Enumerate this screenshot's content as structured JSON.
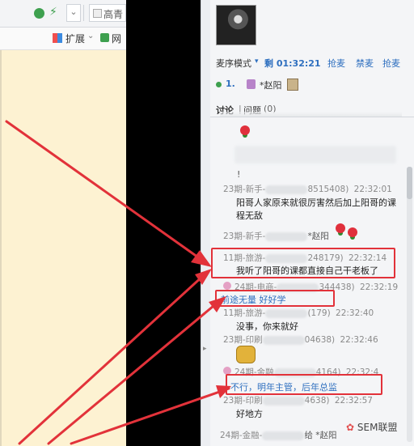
{
  "browser": {
    "tab_title": "高青",
    "toolbar_ext_label": "扩展",
    "toolbar_web_label": "网"
  },
  "room": {
    "mode_label": "麦序模式",
    "timer_prefix": "剩",
    "timer_value": "01:32:21",
    "grab_mic": "抢麦",
    "ban_mic": "禁麦",
    "take_mic": "抢麦",
    "mic_order_index": "1.",
    "mic_user": "*赵阳",
    "tab_discussion": "讨论",
    "tab_question": "问题",
    "question_count": "(0)"
  },
  "chat": {
    "messages": [
      {
        "name": "23期-新手-",
        "id": "8515408)",
        "time": "22:32:01",
        "text_line1": "阳哥人家原来就很厉害然后加上阳哥的课",
        "text_line2": "程无敌"
      },
      {
        "name": "23期-新手-",
        "suffix": "*赵阳"
      },
      {
        "name": "11期-旅游-",
        "id": "248179)",
        "time": "22:32:14",
        "text": "我听了阳哥的课都直接自己干老板了"
      },
      {
        "name": "24期-电商-",
        "id": "344438)",
        "time": "22:32:19",
        "text": "前途无量 好好学"
      },
      {
        "name": "11期-旅游-",
        "id": "(179)",
        "time": "22:32:40",
        "text": "没事，你来就好"
      },
      {
        "name": "23期-印刷",
        "id": "04638)",
        "time": "22:32:46"
      },
      {
        "name": "24期-金融",
        "id": "4164)",
        "time": "22:32:4",
        "text": "不行，明年主管，后年总监"
      },
      {
        "name": "23期-印刷",
        "id": "4638)",
        "time": "22:32:57",
        "text": "好地方"
      },
      {
        "name": "24期-金融-",
        "suffix": "给 *赵阳"
      }
    ]
  },
  "watermark": "SEM联盟",
  "colors": {
    "arrow": "#e2323a",
    "accent": "#2e6fbf"
  }
}
